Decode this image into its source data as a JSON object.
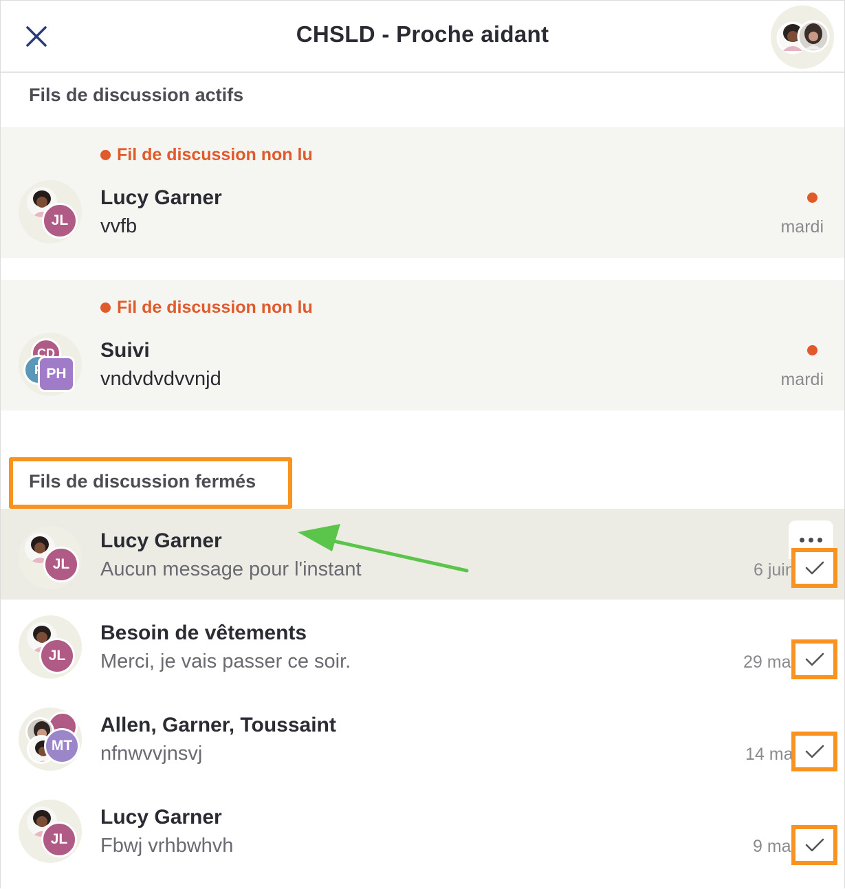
{
  "header": {
    "title": "CHSLD - Proche aidant"
  },
  "sections": {
    "active_heading": "Fils de discussion actifs",
    "closed_heading": "Fils de discussion fermés"
  },
  "active_threads": [
    {
      "unread_label": "Fil de discussion non lu",
      "name": "Lucy Garner",
      "preview": "vvfb",
      "date": "mardi",
      "avatar_initials": "JL"
    },
    {
      "unread_label": "Fil de discussion non lu",
      "name": "Suivi",
      "preview": "vndvdvdvvnjd",
      "date": "mardi",
      "avatar_initials": "PH",
      "avatar_back_initials": "CD",
      "avatar_side_initials": "P"
    }
  ],
  "closed_threads": [
    {
      "name": "Lucy Garner",
      "preview": "Aucun message pour l'instant",
      "date": "6 juin",
      "avatar_initials": "JL"
    },
    {
      "name": "Besoin de vêtements",
      "preview": "Merci, je vais passer ce soir.",
      "date": "29 mai",
      "avatar_initials": "JL"
    },
    {
      "name": "Allen, Garner, Toussaint",
      "preview": "nfnwvvjnsvj",
      "date": "14 mai",
      "avatar_initials": "MT"
    },
    {
      "name": "Lucy Garner",
      "preview": "Fbwj vrhbwhvh",
      "date": "9 mai",
      "avatar_initials": "JL"
    }
  ],
  "icons": {
    "close": "close-icon",
    "more": "more-options-icon",
    "check": "checkmark-icon"
  },
  "colors": {
    "accent_unread": "#e05a2b",
    "annotation_orange": "#f7931e",
    "annotation_green": "#5ac54a",
    "initials_jl": "#b05a86",
    "initials_ph": "#a07cc8",
    "initials_mt": "#9b86c9"
  }
}
